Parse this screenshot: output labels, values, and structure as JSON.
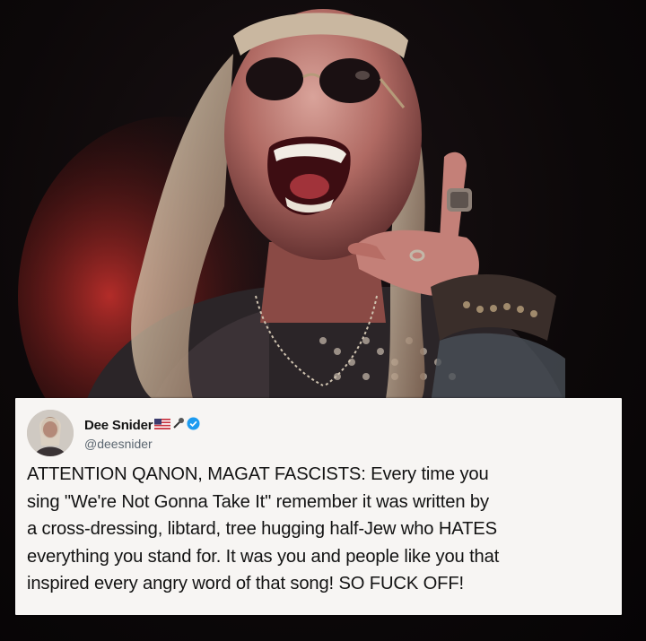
{
  "tweet": {
    "display_name": "Dee Snider",
    "handle": "@deesnider",
    "name_icons": [
      "us-flag-icon",
      "microphone-icon",
      "verified-badge-icon"
    ],
    "lines": [
      "ATTENTION QANON, MAGAT FASCISTS: Every time you",
      "sing \"We're Not Gonna Take It\" remember it was written by",
      "a cross-dressing, libtard, tree hugging half-Jew who HATES",
      "everything you stand for. It was you and people like you that",
      "inspired every angry word of that song! SO FUCK OFF!"
    ]
  },
  "colors": {
    "background": "#0b0708",
    "card": "#f7f5f3",
    "text": "#131313",
    "handle": "#5b6670",
    "verified": "#1d9bf0"
  }
}
